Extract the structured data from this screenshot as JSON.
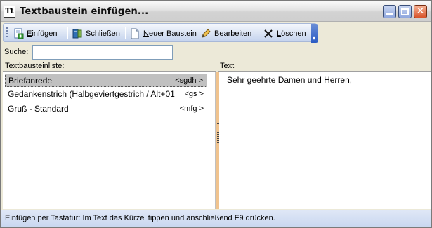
{
  "window": {
    "icon_text": "Tt",
    "title": "Textbaustein einfügen..."
  },
  "toolbar": {
    "insert": {
      "accel": "E",
      "rest": "infügen",
      "icon": "insert-document-icon"
    },
    "close": {
      "label": "Schließen",
      "icon": "book-close-icon"
    },
    "new": {
      "accel": "N",
      "rest": "euer Baustein",
      "icon": "new-document-icon"
    },
    "edit": {
      "label": "Bearbeiten",
      "icon": "pencil-icon"
    },
    "delete": {
      "accel": "L",
      "rest": "öschen",
      "icon": "delete-x-icon"
    }
  },
  "search": {
    "label_accel": "S",
    "label_rest": "uche:",
    "value": ""
  },
  "list": {
    "header": "Textbausteinliste:",
    "items": [
      {
        "name": "Briefanrede",
        "code": "<sgdh >",
        "selected": true
      },
      {
        "name": "Gedankenstrich (Halbgeviertgestrich / Alt+01",
        "code": "<gs >",
        "selected": false
      },
      {
        "name": "Gruß - Standard",
        "code": "<mfg >",
        "selected": false
      }
    ]
  },
  "text": {
    "header": "Text",
    "content": "Sehr geehrte Damen und Herren,"
  },
  "status": {
    "text": "Einfügen per Tastatur: Im Text das Kürzel tippen und anschließend F9 drücken."
  },
  "colors": {
    "splitter": "#f0c38e",
    "selection": "#c0c0c0",
    "toolbar_accent": "#2b5bc4"
  }
}
